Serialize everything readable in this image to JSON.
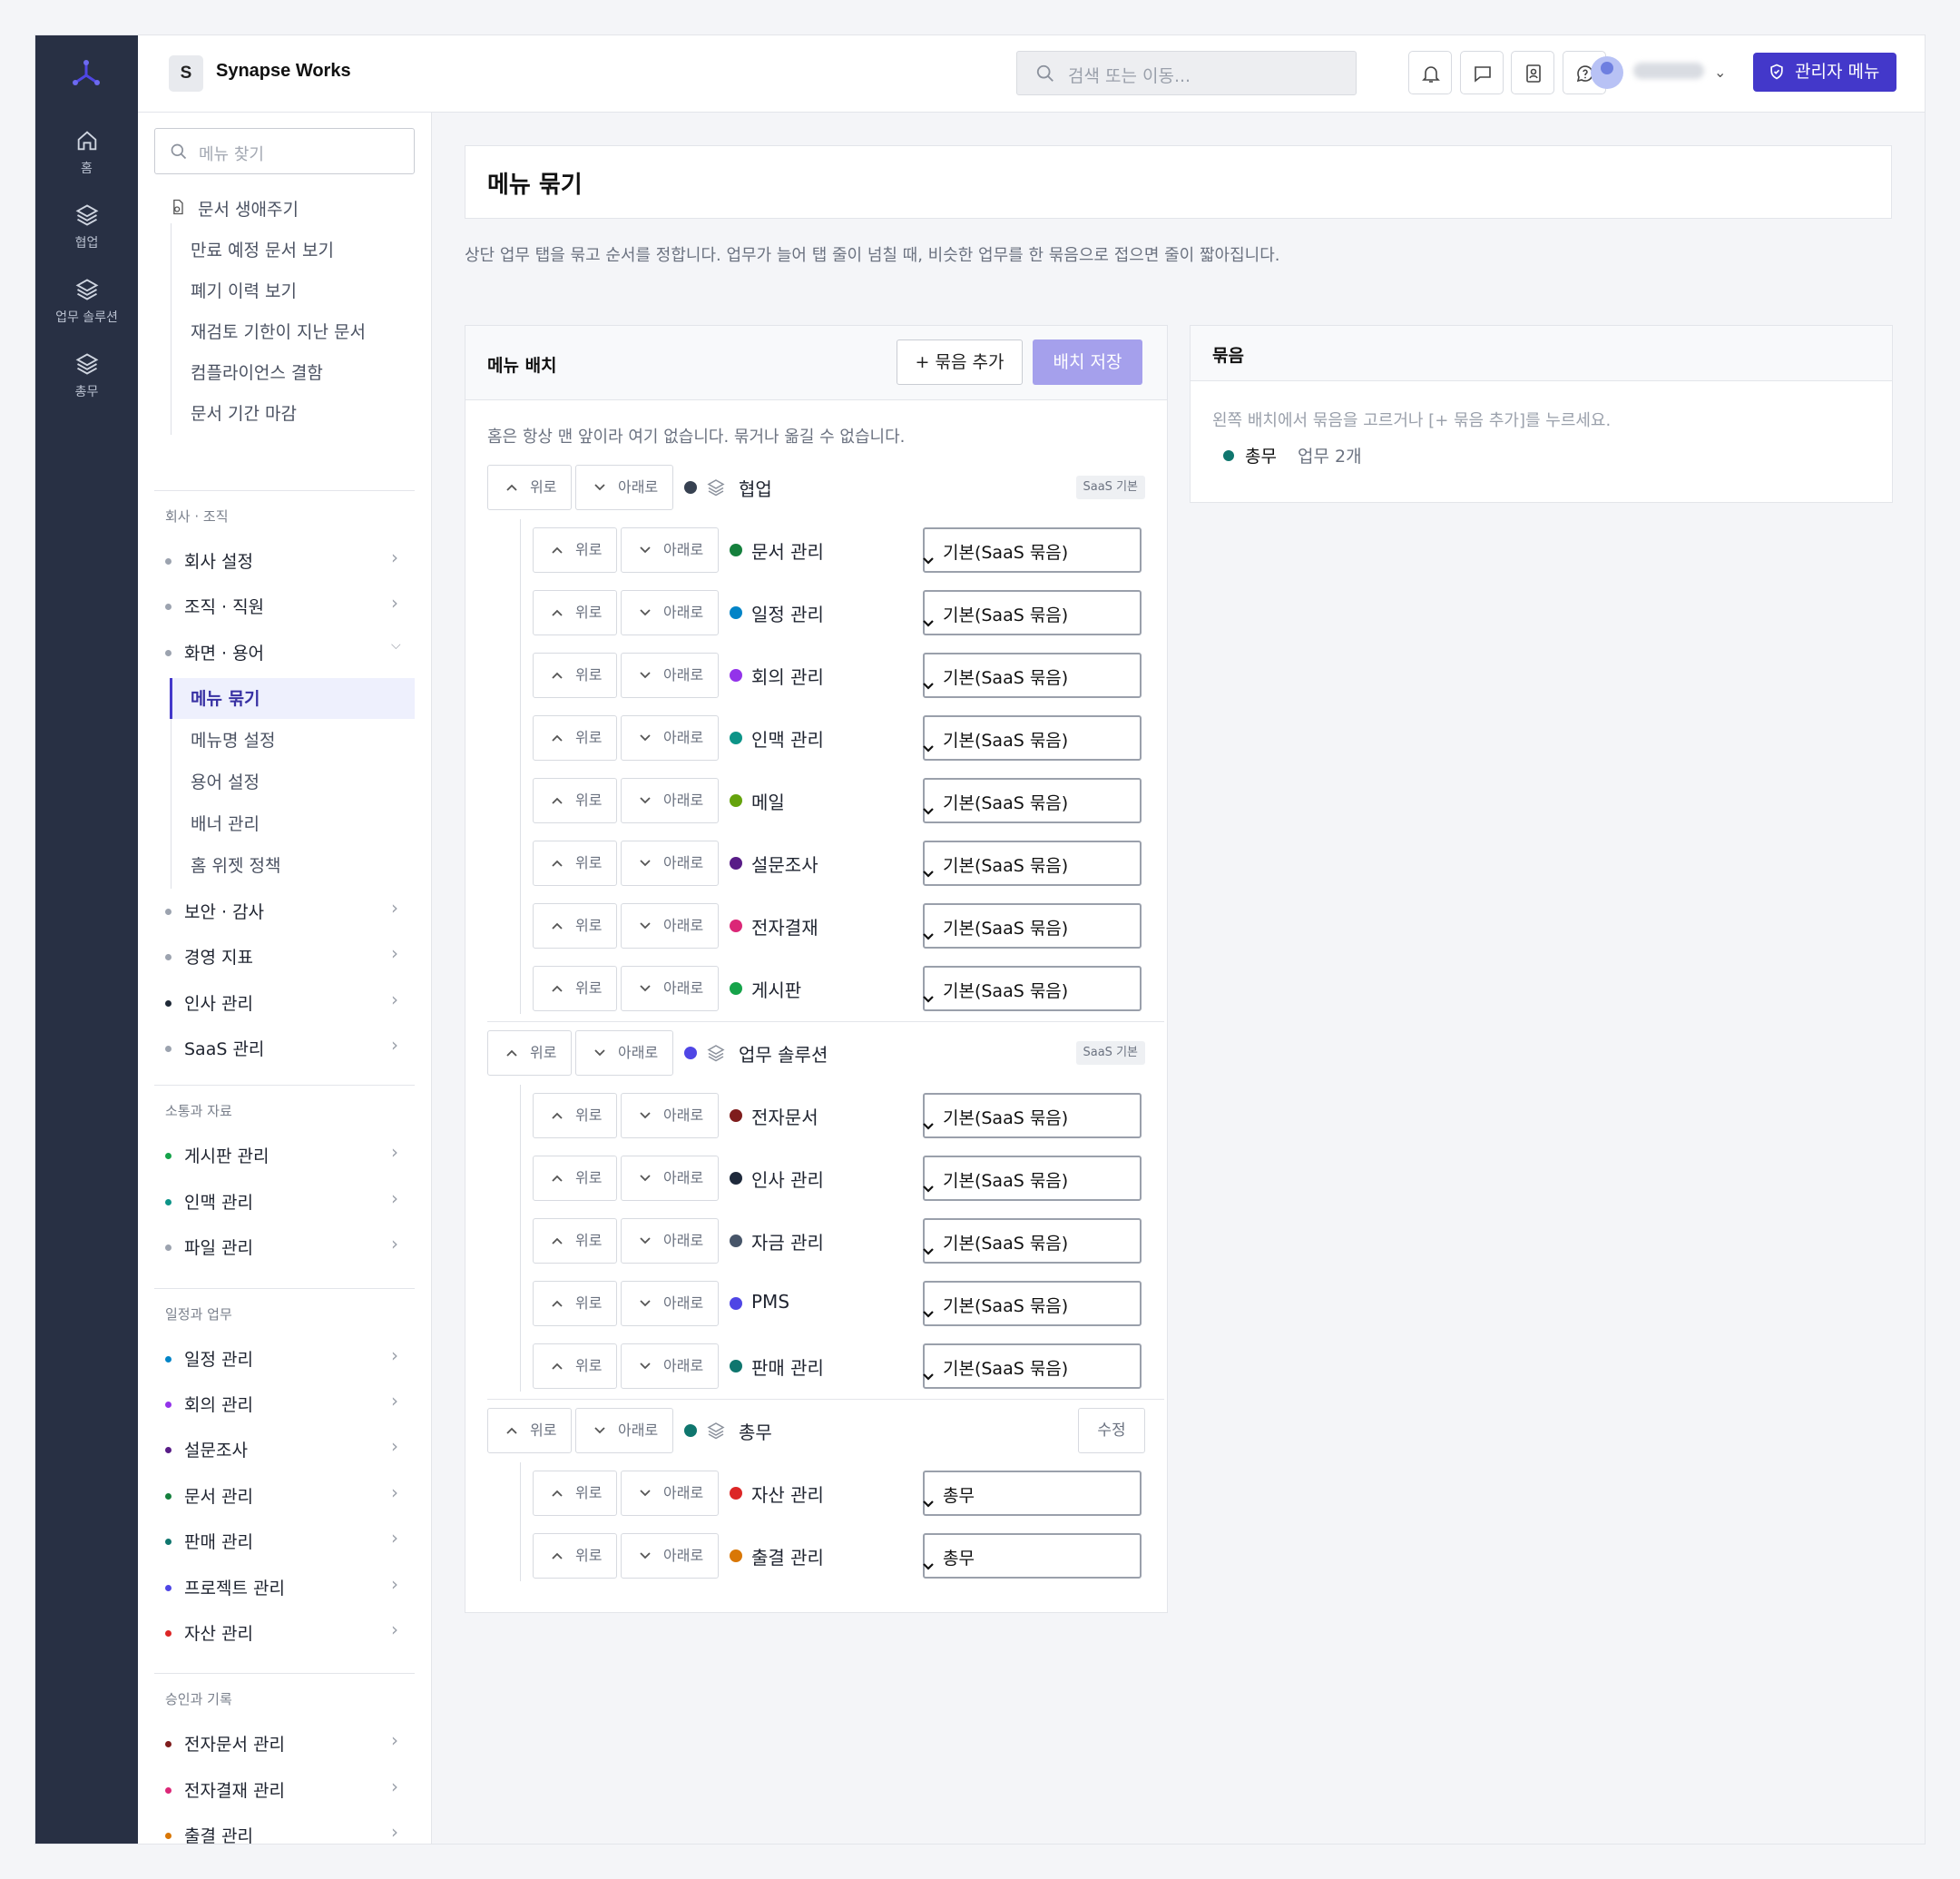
{
  "topbar": {
    "workspace_initial": "S",
    "workspace_name": "Synapse Works",
    "search_placeholder": "검색 또는 이동...",
    "admin_button": "관리자 메뉴"
  },
  "rail": [
    {
      "label": "홈",
      "icon": "home-icon"
    },
    {
      "label": "협업",
      "icon": "layers-icon"
    },
    {
      "label": "업무 솔루션",
      "icon": "layers-icon"
    },
    {
      "label": "총무",
      "icon": "layers-icon"
    }
  ],
  "sidebar": {
    "search_placeholder": "메뉴 찾기",
    "lifecycle": {
      "title": "문서 생애주기",
      "items": [
        "만료 예정 문서 보기",
        "폐기 이력 보기",
        "재검토 기한이 지난 문서",
        "컴플라이언스 결함",
        "문서 기간 마감"
      ]
    },
    "sections": [
      {
        "title": "회사 · 조직",
        "items": [
          {
            "label": "회사 설정",
            "color": "#9ca3af"
          },
          {
            "label": "조직 · 직원",
            "color": "#9ca3af"
          },
          {
            "label": "화면 · 용어",
            "color": "#9ca3af",
            "expanded": true,
            "children": [
              "메뉴 묶기",
              "메뉴명 설정",
              "용어 설정",
              "배너 관리",
              "홈 위젯 정책"
            ]
          },
          {
            "label": "보안 · 감사",
            "color": "#9ca3af"
          },
          {
            "label": "경영 지표",
            "color": "#9ca3af"
          },
          {
            "label": "인사 관리",
            "color": "#1f2937"
          },
          {
            "label": "SaaS 관리",
            "color": "#9ca3af"
          }
        ]
      },
      {
        "title": "소통과 자료",
        "items": [
          {
            "label": "게시판 관리",
            "color": "#16a34a"
          },
          {
            "label": "인맥 관리",
            "color": "#0d9488"
          },
          {
            "label": "파일 관리",
            "color": "#9ca3af"
          }
        ]
      },
      {
        "title": "일정과 업무",
        "items": [
          {
            "label": "일정 관리",
            "color": "#0284c7"
          },
          {
            "label": "회의 관리",
            "color": "#9333ea"
          },
          {
            "label": "설문조사",
            "color": "#581c87"
          },
          {
            "label": "문서 관리",
            "color": "#15803d"
          },
          {
            "label": "판매 관리",
            "color": "#0f766e"
          },
          {
            "label": "프로젝트 관리",
            "color": "#4f46e5"
          },
          {
            "label": "자산 관리",
            "color": "#dc2626"
          }
        ]
      },
      {
        "title": "승인과 기록",
        "items": [
          {
            "label": "전자문서 관리",
            "color": "#7f1d1d"
          },
          {
            "label": "전자결재 관리",
            "color": "#db2777"
          },
          {
            "label": "출결 관리",
            "color": "#d97706"
          }
        ]
      }
    ]
  },
  "page": {
    "title": "메뉴 묶기",
    "description": "상단 업무 탭을 묶고 순서를 정합니다. 업무가 늘어 탭 줄이 넘칠 때, 비슷한 업무를 한 묶음으로 접으면 줄이 짧아집니다."
  },
  "layout_panel": {
    "title": "메뉴 배치",
    "add_group": "+ 묶음 추가",
    "save": "배치 저장",
    "note": "홈은 항상 맨 앞이라 여기 없습니다. 묶거나 옮길 수 없습니다.",
    "up": "위로",
    "down": "아래로",
    "groups": [
      {
        "name": "협업",
        "color": "#374151",
        "tag": "SaaS 기본",
        "items": [
          {
            "name": "문서 관리",
            "color": "#15803d",
            "group": "기본(SaaS 묶음)"
          },
          {
            "name": "일정 관리",
            "color": "#0284c7",
            "group": "기본(SaaS 묶음)"
          },
          {
            "name": "회의 관리",
            "color": "#9333ea",
            "group": "기본(SaaS 묶음)"
          },
          {
            "name": "인맥 관리",
            "color": "#0d9488",
            "group": "기본(SaaS 묶음)"
          },
          {
            "name": "메일",
            "color": "#65a30d",
            "group": "기본(SaaS 묶음)"
          },
          {
            "name": "설문조사",
            "color": "#581c87",
            "group": "기본(SaaS 묶음)"
          },
          {
            "name": "전자결재",
            "color": "#db2777",
            "group": "기본(SaaS 묶음)"
          },
          {
            "name": "게시판",
            "color": "#16a34a",
            "group": "기본(SaaS 묶음)"
          }
        ]
      },
      {
        "name": "업무 솔루션",
        "color": "#4f46e5",
        "tag": "SaaS 기본",
        "items": [
          {
            "name": "전자문서",
            "color": "#7f1d1d",
            "group": "기본(SaaS 묶음)"
          },
          {
            "name": "인사 관리",
            "color": "#1e293b",
            "group": "기본(SaaS 묶음)"
          },
          {
            "name": "자금 관리",
            "color": "#475569",
            "group": "기본(SaaS 묶음)"
          },
          {
            "name": "PMS",
            "color": "#4f46e5",
            "group": "기본(SaaS 묶음)"
          },
          {
            "name": "판매 관리",
            "color": "#0f766e",
            "group": "기본(SaaS 묶음)"
          }
        ]
      },
      {
        "name": "총무",
        "color": "#0f766e",
        "edit": "수정",
        "items": [
          {
            "name": "자산 관리",
            "color": "#dc2626",
            "group": "총무"
          },
          {
            "name": "출결 관리",
            "color": "#d97706",
            "group": "총무"
          }
        ]
      }
    ]
  },
  "group_panel": {
    "title": "묶음",
    "hint": "왼쪽 배치에서 묶음을 고르거나 [+ 묶음 추가]를 누르세요.",
    "groups": [
      {
        "name": "총무",
        "count": "업무 2개",
        "color": "#0f766e"
      }
    ]
  }
}
